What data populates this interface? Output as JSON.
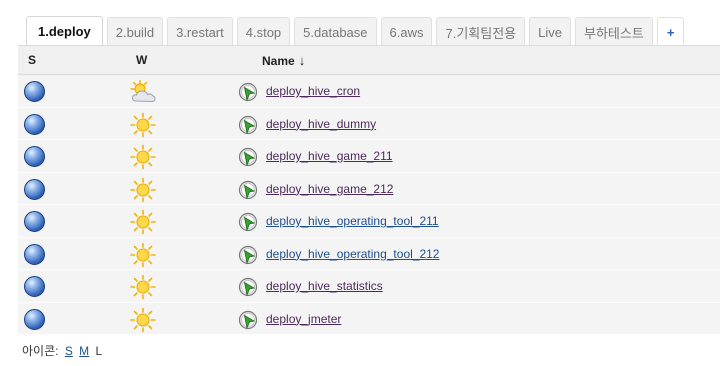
{
  "tabs": [
    {
      "label": "1.deploy",
      "active": true
    },
    {
      "label": "2.build",
      "active": false
    },
    {
      "label": "3.restart",
      "active": false
    },
    {
      "label": "4.stop",
      "active": false
    },
    {
      "label": "5.database",
      "active": false
    },
    {
      "label": "6.aws",
      "active": false
    },
    {
      "label": "7.기획팀전용",
      "active": false
    },
    {
      "label": "Live",
      "active": false
    },
    {
      "label": "부하테스트",
      "active": false
    }
  ],
  "add_tab_label": "+",
  "table": {
    "headers": {
      "status": "S",
      "weather": "W",
      "name": "Name",
      "sort_indicator": "↓"
    },
    "rows": [
      {
        "name": "deploy_hive_cron",
        "status_icon": "blue-ball-icon",
        "weather_icon": "cloudy-sun-icon"
      },
      {
        "name": "deploy_hive_dummy",
        "status_icon": "blue-ball-icon",
        "weather_icon": "sunny-icon"
      },
      {
        "name": "deploy_hive_game_211",
        "status_icon": "blue-ball-icon",
        "weather_icon": "sunny-icon"
      },
      {
        "name": "deploy_hive_game_212",
        "status_icon": "blue-ball-icon",
        "weather_icon": "sunny-icon"
      },
      {
        "name": "deploy_hive_operating_tool_211",
        "status_icon": "blue-ball-icon",
        "weather_icon": "sunny-icon"
      },
      {
        "name": "deploy_hive_operating_tool_212",
        "status_icon": "blue-ball-icon",
        "weather_icon": "sunny-icon"
      },
      {
        "name": "deploy_hive_statistics",
        "status_icon": "blue-ball-icon",
        "weather_icon": "sunny-icon"
      },
      {
        "name": "deploy_jmeter",
        "status_icon": "blue-ball-icon",
        "weather_icon": "sunny-icon"
      }
    ]
  },
  "legend": {
    "label": "아이콘:",
    "sizes": [
      "S",
      "M",
      "L"
    ]
  }
}
